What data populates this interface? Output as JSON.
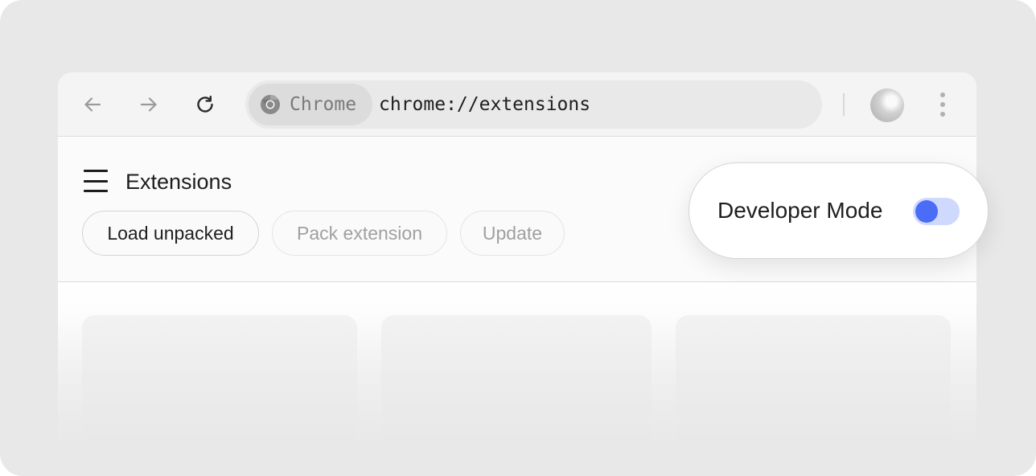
{
  "toolbar": {
    "back_icon": "arrow-left-icon",
    "forward_icon": "arrow-right-icon",
    "reload_icon": "reload-icon",
    "chip_icon": "chrome-logo-icon",
    "chip_label": "Chrome",
    "url": "chrome://extensions",
    "profile_icon": "avatar",
    "menu_icon": "kebab-menu-icon"
  },
  "header": {
    "menu_icon": "hamburger-menu-icon",
    "title": "Extensions",
    "buttons": [
      {
        "label": "Load unpacked",
        "enabled": true
      },
      {
        "label": "Pack extension",
        "enabled": false
      },
      {
        "label": "Update",
        "enabled": false
      }
    ]
  },
  "developer_mode": {
    "label": "Developer Mode",
    "enabled": true,
    "accent": "#4a6cf7",
    "track_color": "#cfd8fd"
  },
  "content": {
    "cards": [
      {
        "state": "placeholder"
      },
      {
        "state": "placeholder"
      },
      {
        "state": "placeholder"
      }
    ]
  }
}
